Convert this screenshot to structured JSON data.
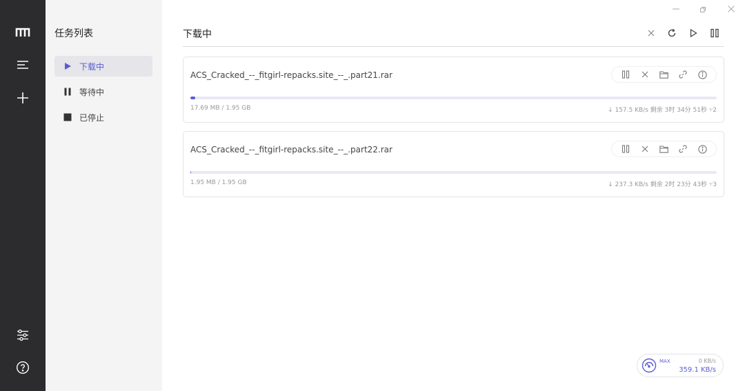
{
  "theme": {
    "accent": "#5b5bd6",
    "rail_bg": "#2c2c2e",
    "panel_bg": "#f4f4f5"
  },
  "rail": {
    "top_icons": [
      "logo-icon",
      "menu-icon",
      "add-icon"
    ],
    "bottom_icons": [
      "preferences-icon",
      "help-icon"
    ]
  },
  "sidebar": {
    "title": "任务列表",
    "items": [
      {
        "label": "下载中",
        "icon": "play-icon",
        "active": true
      },
      {
        "label": "等待中",
        "icon": "pause-icon",
        "active": false
      },
      {
        "label": "已停止",
        "icon": "stop-icon",
        "active": false
      }
    ]
  },
  "window_controls": [
    "minimize-icon",
    "maximize-icon",
    "close-icon"
  ],
  "main": {
    "title": "下载中",
    "toolbar": [
      "delete-icon",
      "refresh-icon",
      "resume-all-icon",
      "pause-all-icon"
    ]
  },
  "tasks": [
    {
      "name": "ACS_Cracked_--_fitgirl-repacks.site_--_.part21.rar",
      "progress": 0.009,
      "size": "17.69 MB / 1.95 GB",
      "speed": "↓ 157.5 KB/s",
      "remaining": "剩余 3时 34分 51秒",
      "connections": "2"
    },
    {
      "name": "ACS_Cracked_--_fitgirl-repacks.site_--_.part22.rar",
      "progress": 0.001,
      "size": "1.95 MB / 1.95 GB",
      "speed": "↓ 237.3 KB/s",
      "remaining": "剩余 2时 23分 43秒",
      "connections": "3"
    }
  ],
  "task_actions": [
    "pause-icon",
    "delete-icon",
    "folder-icon",
    "link-icon",
    "info-icon"
  ],
  "speedometer": {
    "mode": "MAX",
    "upload": "0 KB/s",
    "download": "359.1 KB/s"
  }
}
